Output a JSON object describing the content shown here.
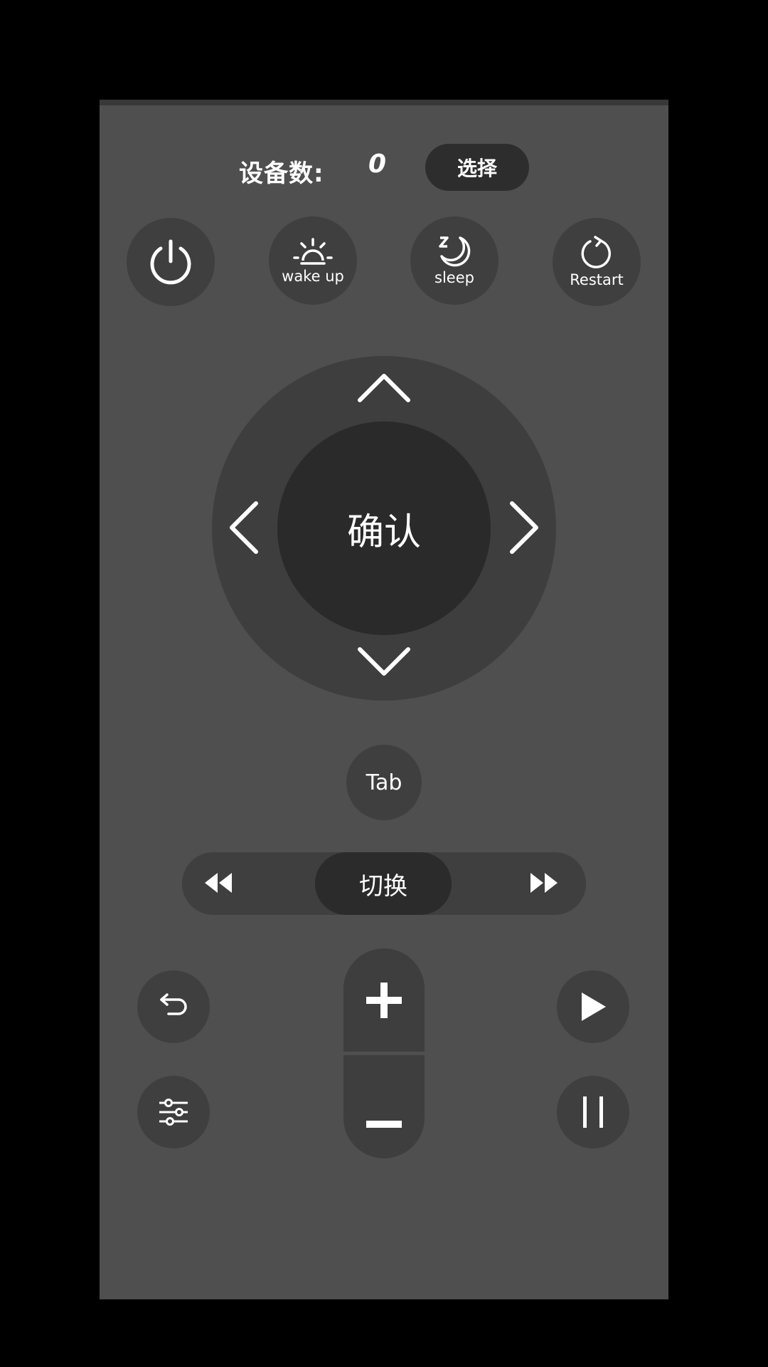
{
  "header": {
    "device_count_label": "设备数:",
    "device_count_value": "0",
    "select_label": "选择"
  },
  "top_buttons": {
    "power_icon": "power-icon",
    "wake_up_label": "wake up",
    "sleep_label": "sleep",
    "restart_label": "Restart"
  },
  "dpad": {
    "ok_label": "确认"
  },
  "tab_label": "Tab",
  "switch_bar": {
    "rewind_icon": "rewind-icon",
    "switch_label": "切换",
    "forward_icon": "fast-forward-icon"
  },
  "bottom_controls": {
    "back_icon": "back-icon",
    "settings_icon": "sliders-icon",
    "volume_up_icon": "plus-icon",
    "volume_down_icon": "minus-icon",
    "play_icon": "play-icon",
    "pause_icon": "pause-icon"
  },
  "colors": {
    "panel": "#4f4f4f",
    "button": "#3f3f3f",
    "button_dark": "#2a2a2a",
    "text": "#ffffff"
  }
}
